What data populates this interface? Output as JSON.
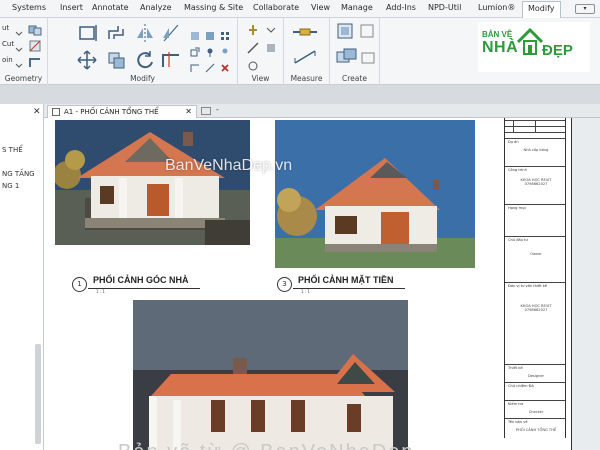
{
  "menu": {
    "items": [
      "Systems",
      "Insert",
      "Annotate",
      "Analyze",
      "Massing & Site",
      "Collaborate",
      "View",
      "Manage",
      "Add-Ins",
      "NPD-Util",
      "Lumion®",
      "Modify"
    ],
    "active": "Modify",
    "mini_control": "▾"
  },
  "ribbon": {
    "groups": [
      "Geometry",
      "Modify",
      "View",
      "Measure",
      "Create"
    ],
    "side_labels": [
      "ut",
      "Cut",
      "oin"
    ]
  },
  "logo": {
    "line1": "BẢN VẼ",
    "line2": "NHÀ",
    "line3": "ĐẸP"
  },
  "left_panel": {
    "close": "✕",
    "items": [
      "S THỂ",
      "NG TẦNG",
      "NG 1"
    ]
  },
  "tab": {
    "title": "A1 - PHỐI CẢNH TỔNG THỂ",
    "close": "✕",
    "extra": "-"
  },
  "sheet": {
    "views": [
      {
        "number": "1",
        "title": "PHỐI CẢNH GÓC NHÀ",
        "scale": "1 : 1"
      },
      {
        "number": "3",
        "title": "PHỐI CẢNH MẶT TIỀN",
        "scale": "1 : 1"
      }
    ],
    "watermark": "BanVeNhaDep.vn",
    "bottom_text": "Bản vẽ từ @ BanVeNhaDep"
  },
  "title_block": {
    "rows": [
      {
        "label": "Dự án",
        "value": "Nhà cấp bóng"
      },
      {
        "label": "Công trình",
        "value": "KHÓA HỌC REVIT 0798662027"
      },
      {
        "label": "Hạng mục",
        "value": ""
      },
      {
        "label": "Chủ đầu tư",
        "value": "Owner"
      },
      {
        "label": "Đơn vị tư vấn thiết kế",
        "value": "KHÓA HỌC REVIT 0798662027"
      },
      {
        "label": "Thiết kế",
        "value": "Designer"
      },
      {
        "label": "Chủ nhiệm ĐA",
        "value": ""
      },
      {
        "label": "Kiểm tra",
        "value": "Checker"
      },
      {
        "label": "Tên bản vẽ",
        "value": "PHỐI CẢNH TỔNG THỂ"
      }
    ]
  },
  "colors": {
    "roof": "#d9714a",
    "wall": "#f2efe9",
    "sky": "#3f7fbf",
    "logo_green": "#2e9a3a",
    "ribbon_bg": "#f5f6f7"
  }
}
